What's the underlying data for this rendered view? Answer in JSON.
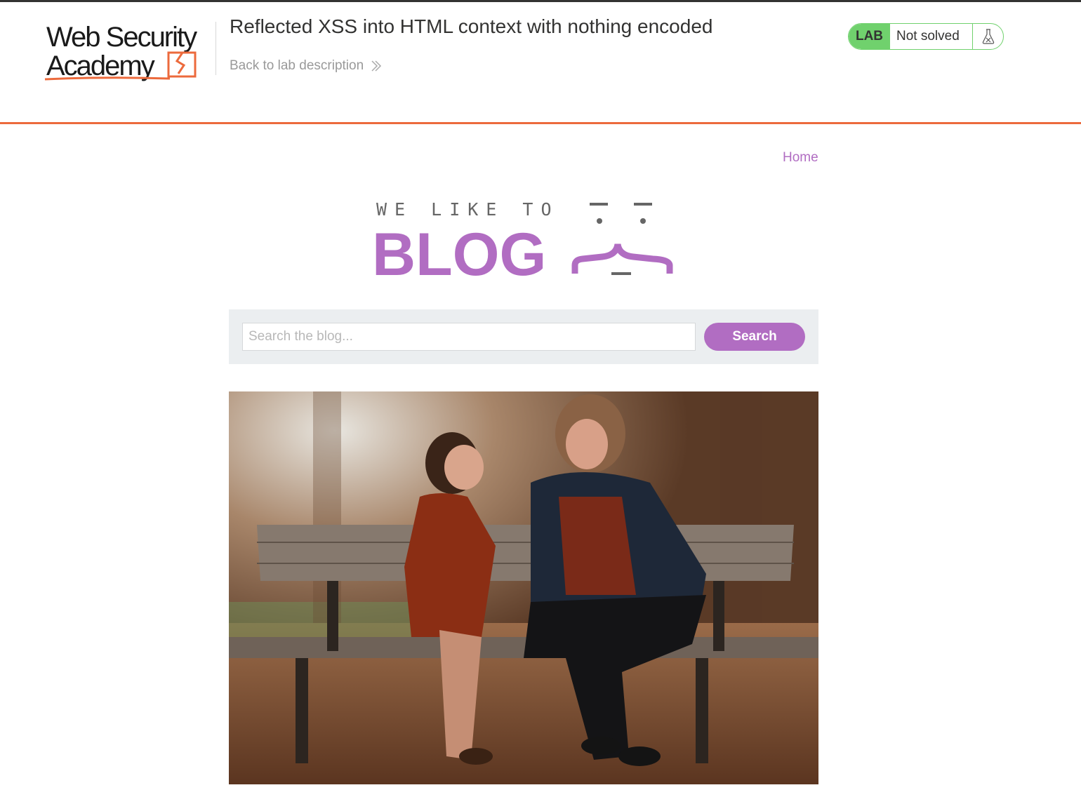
{
  "header": {
    "logo_line1": "Web Security",
    "logo_line2": "Academy",
    "lab_title": "Reflected XSS into HTML context with nothing encoded",
    "back_link": "Back to lab description",
    "status_badge": "LAB",
    "status_text": "Not solved",
    "status_icon": "flask-icon"
  },
  "nav": {
    "home_label": "Home"
  },
  "blog_banner": {
    "tagline": "WE LIKE TO",
    "title": "BLOG"
  },
  "search": {
    "placeholder": "Search the blog...",
    "value": "",
    "button_label": "Search"
  },
  "colors": {
    "accent_orange": "#ec6a3c",
    "purple": "#b16dc2",
    "lab_green": "#70d16d",
    "panel_gray": "#ebeef0"
  }
}
